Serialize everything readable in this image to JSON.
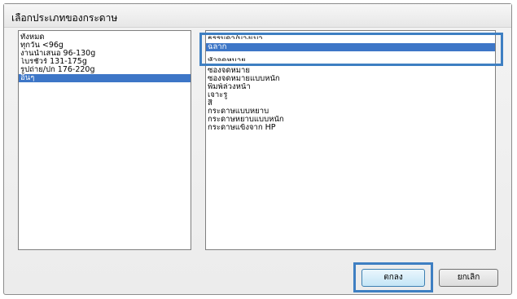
{
  "dialog": {
    "title": "เลือกประเภทของกระดาษ"
  },
  "left_list": {
    "items": [
      {
        "label": "ทั้งหมด",
        "selected": false
      },
      {
        "label": "ทุกวัน <96g",
        "selected": false
      },
      {
        "label": "งานนำเสนอ 96-130g",
        "selected": false
      },
      {
        "label": "โบรชัวร์ 131-175g",
        "selected": false
      },
      {
        "label": "รูปถ่าย/ปก 176-220g",
        "selected": false
      },
      {
        "label": "อื่นๆ",
        "selected": true
      }
    ]
  },
  "right_list": {
    "cut_top": "ธรรมดา/บางเบา",
    "items": [
      {
        "label": "ฉลาก",
        "selected": true
      },
      {
        "label": "หัวจดหมาย",
        "selected": false,
        "partial": true
      },
      {
        "label": "ซองจดหมาย",
        "selected": false
      },
      {
        "label": "ซองจดหมายแบบหนัก",
        "selected": false
      },
      {
        "label": "พิมพ์ล่วงหน้า",
        "selected": false
      },
      {
        "label": "เจาะรู",
        "selected": false
      },
      {
        "label": "สี",
        "selected": false
      },
      {
        "label": "กระดาษแบบหยาบ",
        "selected": false
      },
      {
        "label": "กระดาษหยาบแบบหนัก",
        "selected": false
      },
      {
        "label": "กระดาษแข็งจาก HP",
        "selected": false
      }
    ]
  },
  "buttons": {
    "ok_label": "ตกลง",
    "cancel_label": "ยกเลิก"
  },
  "colors": {
    "selection": "#3d76c7",
    "callout": "#3e7fc2"
  }
}
